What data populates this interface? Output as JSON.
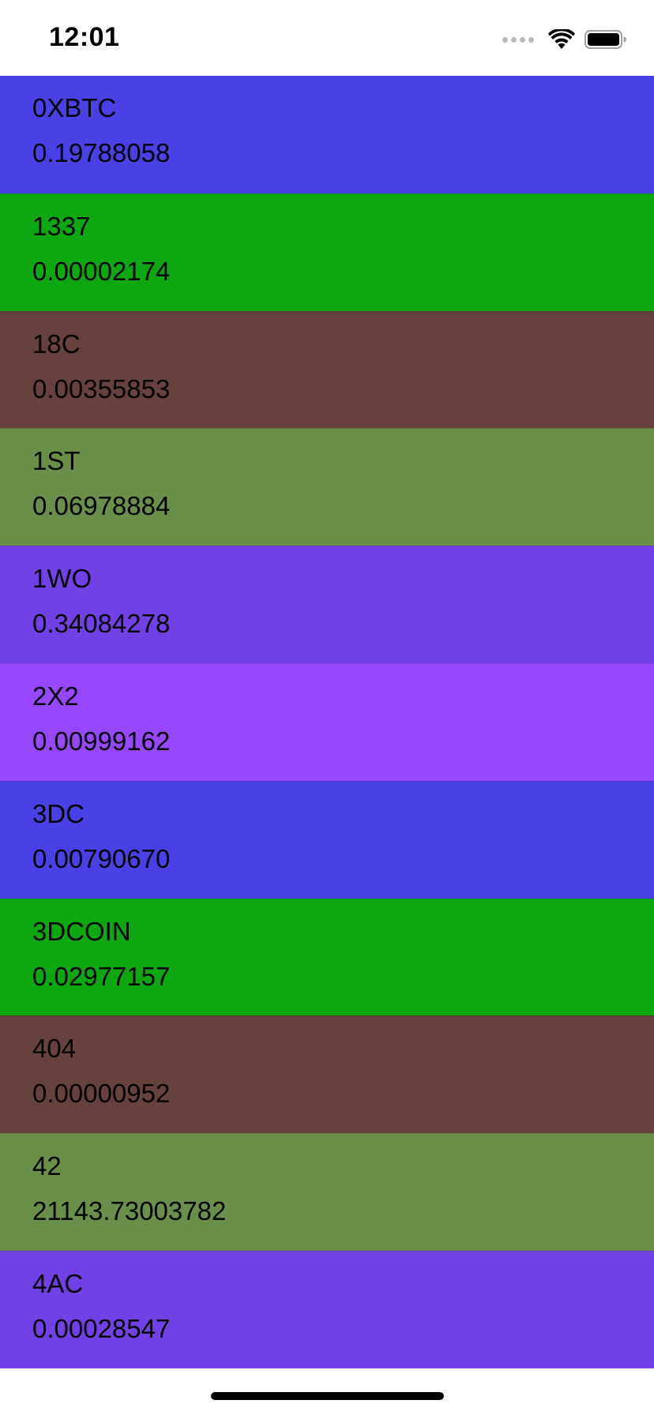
{
  "status_bar": {
    "time": "12:01",
    "icons": [
      "signal-dots-icon",
      "wifi-icon",
      "battery-icon"
    ]
  },
  "coins": [
    {
      "symbol": "0XBTC",
      "price": "0.19788058",
      "color": "#4940E6"
    },
    {
      "symbol": "1337",
      "price": "0.00002174",
      "color": "#0DA712"
    },
    {
      "symbol": "18C",
      "price": "0.00355853",
      "color": "#67413D"
    },
    {
      "symbol": "1ST",
      "price": "0.06978884",
      "color": "#6A8F49"
    },
    {
      "symbol": "1WO",
      "price": "0.34084278",
      "color": "#7141E6"
    },
    {
      "symbol": "2X2",
      "price": "0.00999162",
      "color": "#9748FF"
    },
    {
      "symbol": "3DC",
      "price": "0.00790670",
      "color": "#4940E6"
    },
    {
      "symbol": "3DCOIN",
      "price": "0.02977157",
      "color": "#0DA712"
    },
    {
      "symbol": "404",
      "price": "0.00000952",
      "color": "#67413D"
    },
    {
      "symbol": "42",
      "price": "21143.73003782",
      "color": "#6A8F49"
    },
    {
      "symbol": "4AC",
      "price": "0.00028547",
      "color": "#7141E6"
    }
  ]
}
